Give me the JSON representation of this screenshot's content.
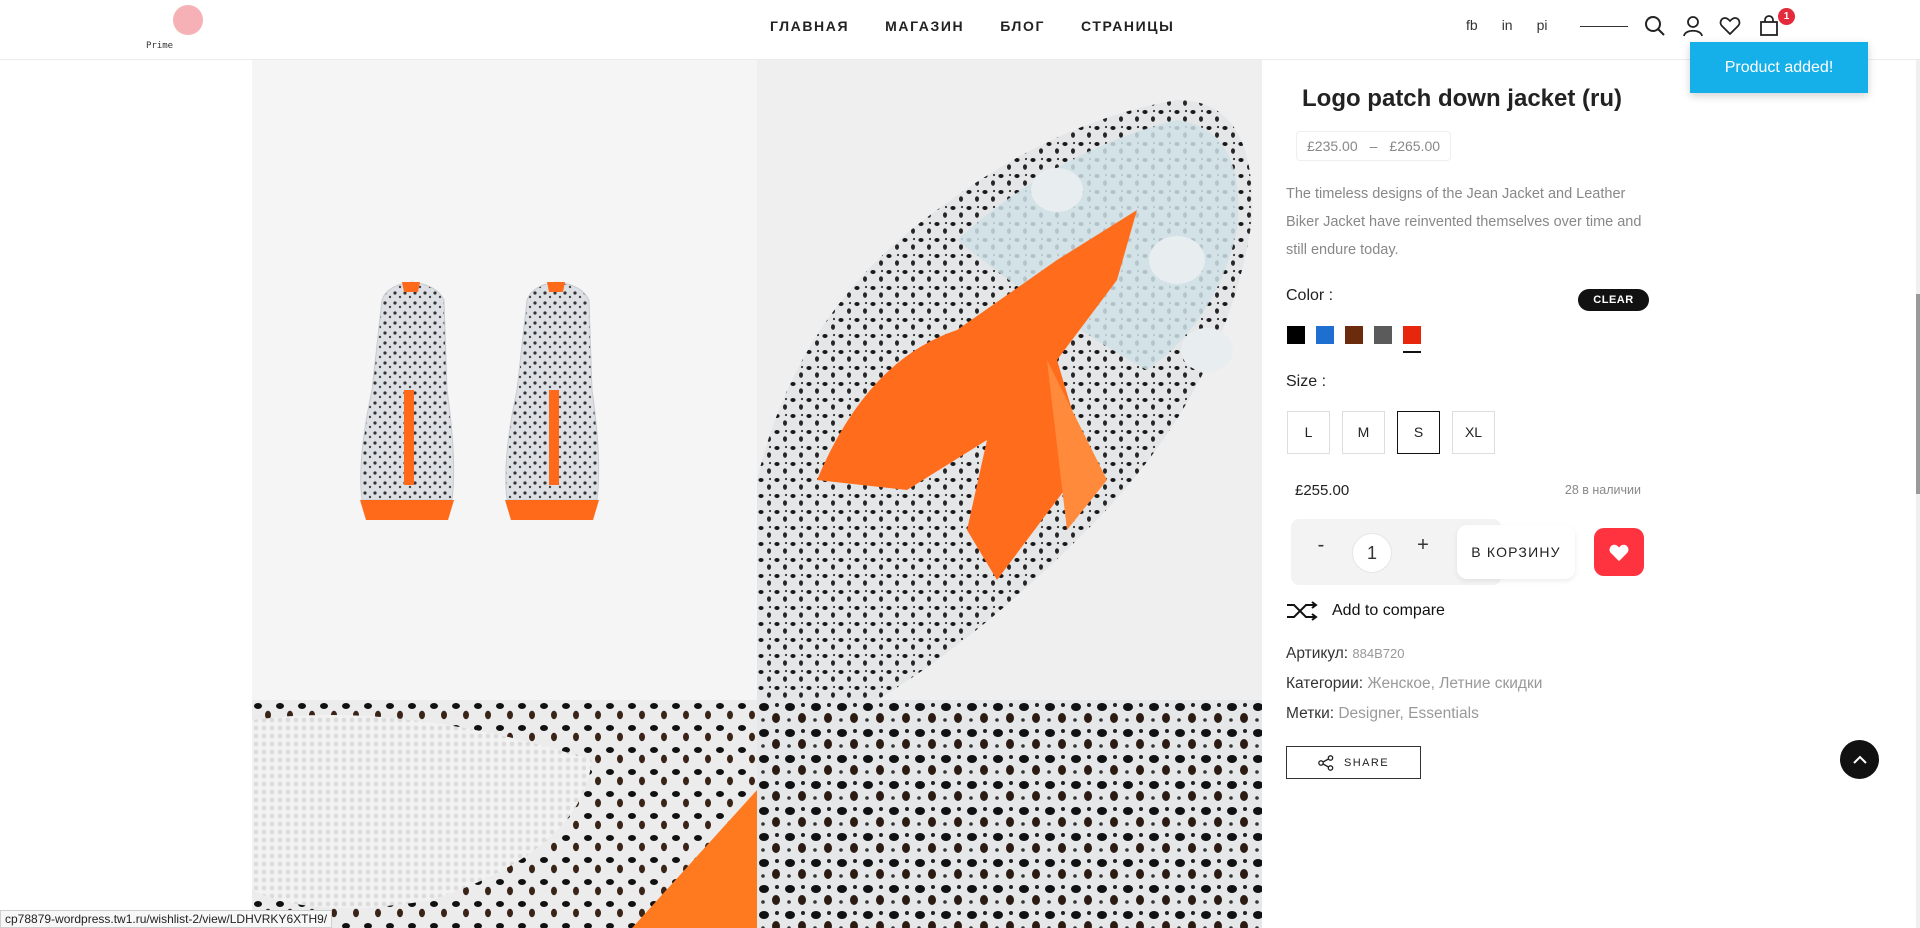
{
  "header": {
    "logo_text": "Prime",
    "nav": [
      "ГЛАВНАЯ",
      "МАГАЗИН",
      "БЛОГ",
      "СТРАНИЦЫ"
    ],
    "social": [
      "fb",
      "in",
      "pi"
    ],
    "cart_count": "1",
    "icons": [
      "search-icon",
      "user-icon",
      "heart-icon",
      "shopping-bag-icon"
    ]
  },
  "toast": {
    "text": "Product added!"
  },
  "product": {
    "title": "Logo patch down jacket (ru)",
    "price_min": "£235.00",
    "price_sep": "–",
    "price_max": "£265.00",
    "description": "The timeless designs of the Jean Jacket and Leather Biker Jacket have reinvented themselves over time and still endure today.",
    "color_label": "Color :",
    "clear_label": "CLEAR",
    "colors": [
      "#000000",
      "#1e6fd0",
      "#6b2b0d",
      "#5b5b5b",
      "#e8260d"
    ],
    "selected_color_index": 4,
    "size_label": "Size :",
    "sizes": [
      "L",
      "M",
      "S",
      "XL"
    ],
    "selected_size": "S",
    "variation_price": "£255.00",
    "stock": "28 в наличии",
    "qty_minus": "-",
    "qty": "1",
    "qty_plus": "+",
    "add_to_cart": "В КОРЗИНУ",
    "compare": "Add to compare",
    "sku_label": "Артикул:",
    "sku": "884B720",
    "categories_label": "Категории:",
    "categories": [
      "Женское",
      "Летние скидки"
    ],
    "tags_label": "Метки:",
    "tags": [
      "Designer",
      "Essentials"
    ],
    "share": "SHARE",
    "accent": "#ff3340"
  },
  "status_bar": {
    "url": "cp78879-wordpress.tw1.ru/wishlist-2/view/LDHVRKY6XTH9/"
  }
}
